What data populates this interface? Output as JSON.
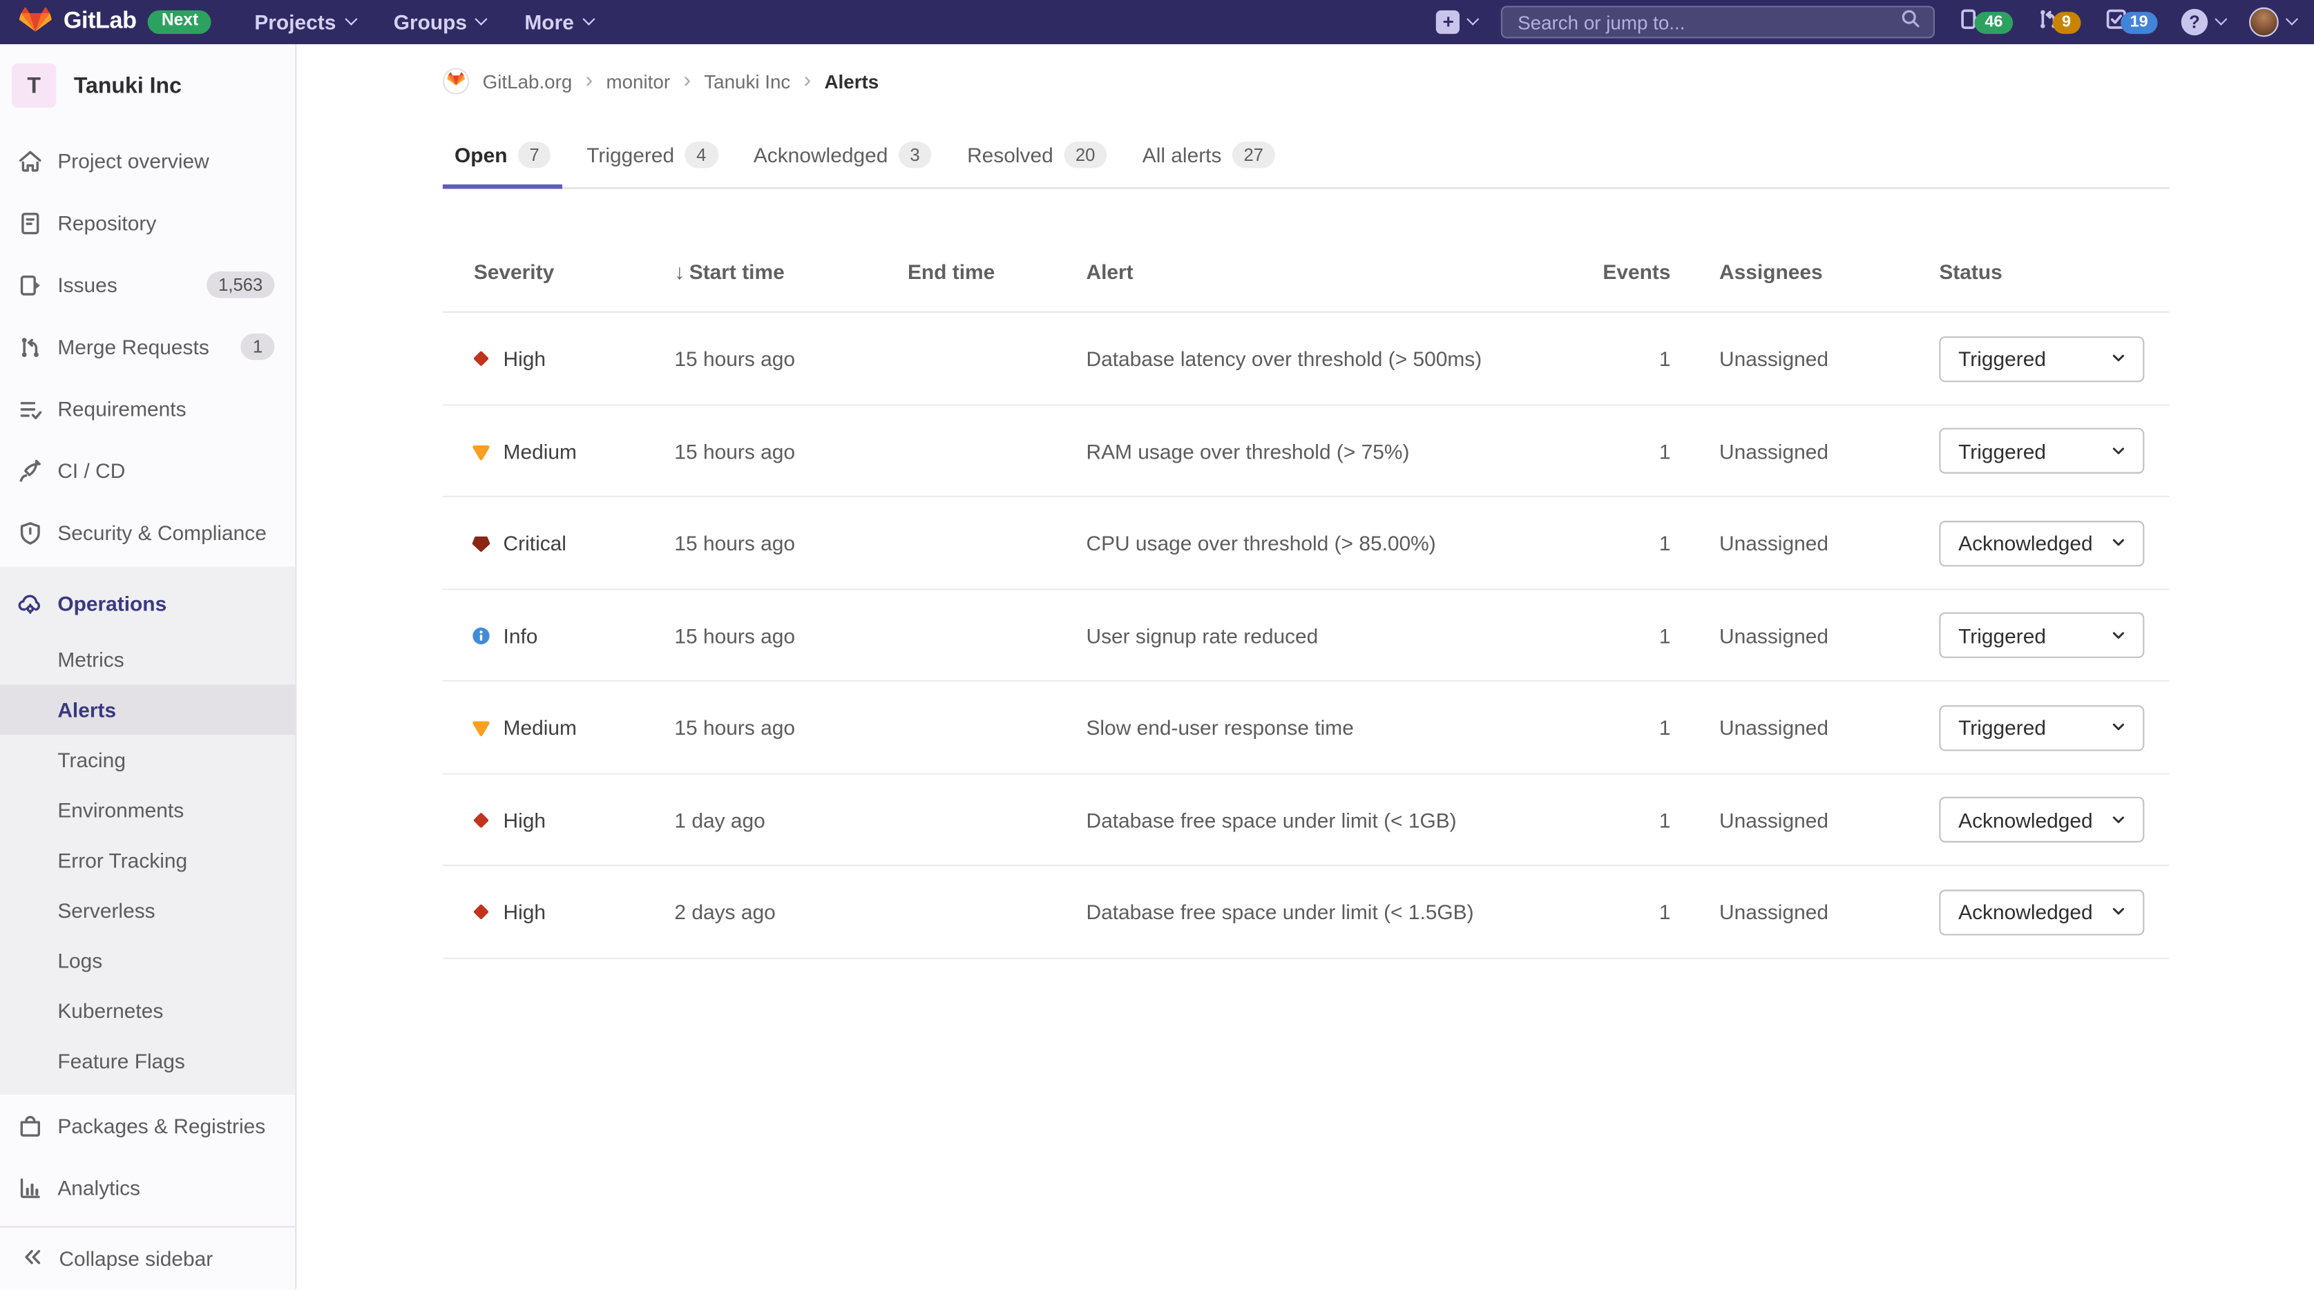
{
  "navbar": {
    "brand": "GitLab",
    "next_badge": "Next",
    "menus": [
      {
        "label": "Projects"
      },
      {
        "label": "Groups"
      },
      {
        "label": "More"
      }
    ],
    "plus_label": "+",
    "search": {
      "placeholder": "Search or jump to..."
    },
    "counters": {
      "issues": "46",
      "merge_requests": "9",
      "todos": "19"
    },
    "help_label": "?"
  },
  "sidebar": {
    "project": {
      "initial": "T",
      "name": "Tanuki Inc"
    },
    "items": [
      {
        "label": "Project overview",
        "icon": "home"
      },
      {
        "label": "Repository",
        "icon": "repository"
      },
      {
        "label": "Issues",
        "icon": "issues",
        "badge": "1,563"
      },
      {
        "label": "Merge Requests",
        "icon": "merge-request",
        "badge": "1"
      },
      {
        "label": "Requirements",
        "icon": "requirements"
      },
      {
        "label": "CI / CD",
        "icon": "ci-cd"
      },
      {
        "label": "Security & Compliance",
        "icon": "shield"
      },
      {
        "label": "Operations",
        "icon": "operations",
        "active": true,
        "children": [
          {
            "label": "Metrics"
          },
          {
            "label": "Alerts",
            "active": true
          },
          {
            "label": "Tracing"
          },
          {
            "label": "Environments"
          },
          {
            "label": "Error Tracking"
          },
          {
            "label": "Serverless"
          },
          {
            "label": "Logs"
          },
          {
            "label": "Kubernetes"
          },
          {
            "label": "Feature Flags"
          }
        ]
      },
      {
        "label": "Packages & Registries",
        "icon": "package"
      },
      {
        "label": "Analytics",
        "icon": "analytics"
      }
    ],
    "collapse_label": "Collapse sidebar"
  },
  "breadcrumb": {
    "items": [
      "GitLab.org",
      "monitor",
      "Tanuki Inc"
    ],
    "current": "Alerts"
  },
  "tabs": [
    {
      "label": "Open",
      "count": "7",
      "active": true
    },
    {
      "label": "Triggered",
      "count": "4"
    },
    {
      "label": "Acknowledged",
      "count": "3"
    },
    {
      "label": "Resolved",
      "count": "20"
    },
    {
      "label": "All alerts",
      "count": "27"
    }
  ],
  "table": {
    "columns": [
      "Severity",
      "Start time",
      "End time",
      "Alert",
      "Events",
      "Assignees",
      "Status"
    ],
    "sort": {
      "column": "Start time",
      "direction": "desc"
    },
    "rows": [
      {
        "severity": "High",
        "severity_level": "high",
        "start_time": "15 hours ago",
        "end_time": "",
        "alert": "Database latency over threshold (> 500ms)",
        "events": "1",
        "assignees": "Unassigned",
        "status": "Triggered"
      },
      {
        "severity": "Medium",
        "severity_level": "medium",
        "start_time": "15 hours ago",
        "end_time": "",
        "alert": "RAM usage over threshold (> 75%)",
        "events": "1",
        "assignees": "Unassigned",
        "status": "Triggered"
      },
      {
        "severity": "Critical",
        "severity_level": "critical",
        "start_time": "15 hours ago",
        "end_time": "",
        "alert": "CPU usage over threshold (> 85.00%)",
        "events": "1",
        "assignees": "Unassigned",
        "status": "Acknowledged"
      },
      {
        "severity": "Info",
        "severity_level": "info",
        "start_time": "15 hours ago",
        "end_time": "",
        "alert": "User signup rate reduced",
        "events": "1",
        "assignees": "Unassigned",
        "status": "Triggered"
      },
      {
        "severity": "Medium",
        "severity_level": "medium",
        "start_time": "15 hours ago",
        "end_time": "",
        "alert": "Slow end-user response time",
        "events": "1",
        "assignees": "Unassigned",
        "status": "Triggered"
      },
      {
        "severity": "High",
        "severity_level": "high",
        "start_time": "1 day ago",
        "end_time": "",
        "alert": "Database free space under limit (< 1GB)",
        "events": "1",
        "assignees": "Unassigned",
        "status": "Acknowledged"
      },
      {
        "severity": "High",
        "severity_level": "high",
        "start_time": "2 days ago",
        "end_time": "",
        "alert": "Database free space under limit (< 1.5GB)",
        "events": "1",
        "assignees": "Unassigned",
        "status": "Acknowledged"
      }
    ]
  },
  "colors": {
    "nav_bg": "#2f2b62",
    "indigo_active": "#393982",
    "tab_indicator": "#5e5cbd",
    "counter_green": "#2da160",
    "counter_orange": "#ca8300",
    "counter_blue": "#4285d8",
    "severity_critical": "#8b2615",
    "severity_high": "#c0341d",
    "severity_medium": "#fa9f1f",
    "severity_info": "#418cd8"
  }
}
